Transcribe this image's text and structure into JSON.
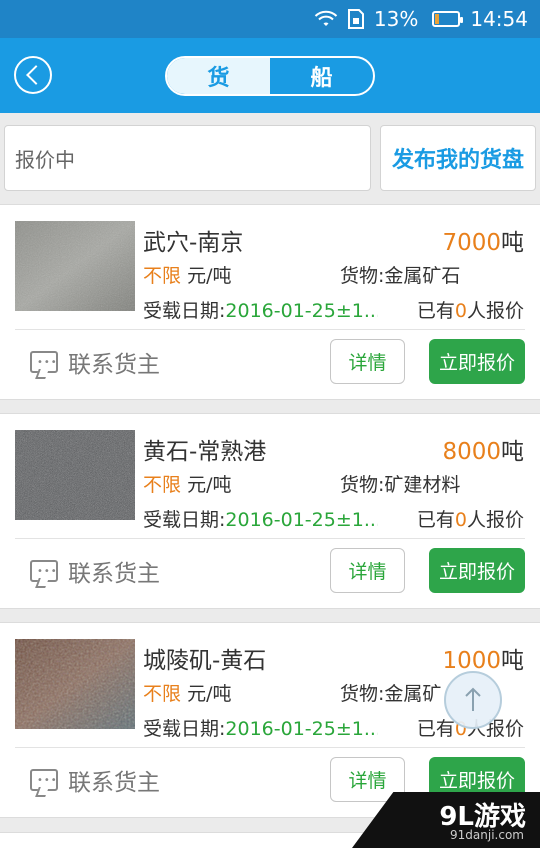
{
  "status_bar": {
    "battery_percent": "13%",
    "time": "14:54"
  },
  "header": {
    "tabs": [
      {
        "label": "货",
        "active": true
      },
      {
        "label": "船",
        "active": false
      }
    ]
  },
  "search": {
    "value": "报价中",
    "publish_label": "发布我的货盘"
  },
  "labels": {
    "unit_ton": "吨",
    "price_unit": "元/吨",
    "cargo_prefix": "货物:",
    "date_prefix": "受载日期:",
    "offers_prefix": "已有",
    "offers_suffix": "人报价",
    "contact": "联系货主",
    "detail": "详情",
    "quote": "立即报价"
  },
  "cards": [
    {
      "route": "武穴-南京",
      "weight": "7000",
      "price": "不限",
      "cargo": "金属矿石",
      "date": "2016-01-25±1...",
      "offers": "0"
    },
    {
      "route": "黄石-常熟港",
      "weight": "8000",
      "price": "不限",
      "cargo": "矿建材料",
      "date": "2016-01-25±1...",
      "offers": "0"
    },
    {
      "route": "城陵矶-黄石",
      "weight": "1000",
      "price": "不限",
      "cargo": "金属矿",
      "date": "2016-01-25±1...",
      "offers": "0"
    }
  ],
  "watermark": {
    "brand": "9L游戏",
    "site": "91danji.com"
  },
  "colors": {
    "header_blue": "#1a9be3",
    "status_blue": "#1f84c7",
    "orange": "#e8801c",
    "green": "#2aa63a",
    "button_green": "#2ea54a"
  }
}
